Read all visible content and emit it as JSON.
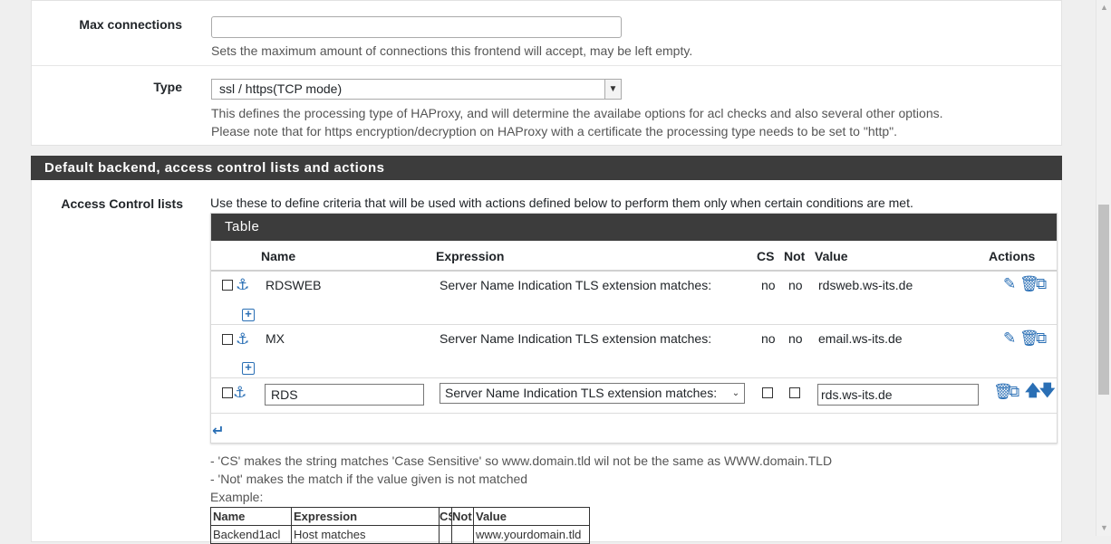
{
  "fields": {
    "max_connections": {
      "label": "Max connections",
      "value": "",
      "help": "Sets the maximum amount of connections this frontend will accept, may be left empty."
    },
    "type": {
      "label": "Type",
      "selected": "ssl / https(TCP mode)",
      "help_line1": "This defines the processing type of HAProxy, and will determine the availabe options for acl checks and also several other options.",
      "help_line2": "Please note that for https encryption/decryption on HAProxy with a certificate the processing type needs to be set to \"http\"."
    }
  },
  "section": {
    "title": "Default backend, access control lists and actions"
  },
  "acl": {
    "label": "Access Control lists",
    "description": "Use these to define criteria that will be used with actions defined below to perform them only when certain conditions are met.",
    "table_title": "Table",
    "columns": [
      "Name",
      "Expression",
      "CS",
      "Not",
      "Value",
      "Actions"
    ],
    "rows": [
      {
        "name": "RDSWEB",
        "expression": "Server Name Indication TLS extension matches:",
        "cs": "no",
        "not": "no",
        "value": "rdsweb.ws-its.de"
      },
      {
        "name": "MX",
        "expression": "Server Name Indication TLS extension matches:",
        "cs": "no",
        "not": "no",
        "value": "email.ws-its.de"
      }
    ],
    "edit_row": {
      "name": "RDS",
      "expression": "Server Name Indication TLS extension matches:",
      "value": "rds.ws-its.de"
    },
    "notes": {
      "cs": "- 'CS' makes the string matches 'Case Sensitive' so www.domain.tld wil not be the same as WWW.domain.TLD",
      "not": "- 'Not' makes the match if the value given is not matched",
      "example": "Example:"
    },
    "example_table": {
      "headers": [
        "Name",
        "Expression",
        "CS",
        "Not",
        "Value"
      ],
      "row": [
        "Backend1acl",
        "Host matches",
        "",
        "",
        "www.yourdomain.tld"
      ]
    }
  },
  "icons": {
    "anchor": "anchor-icon",
    "edit": "pencil-icon",
    "delete": "trash-icon",
    "copy": "copy-icon",
    "add": "plus-square-icon",
    "move_up": "arrow-up-icon",
    "move_down": "arrow-down-icon",
    "move_bottom": "turn-down-icon"
  },
  "colors": {
    "header_bg": "#3c3c3c",
    "icon_blue": "#2a6fb5"
  }
}
